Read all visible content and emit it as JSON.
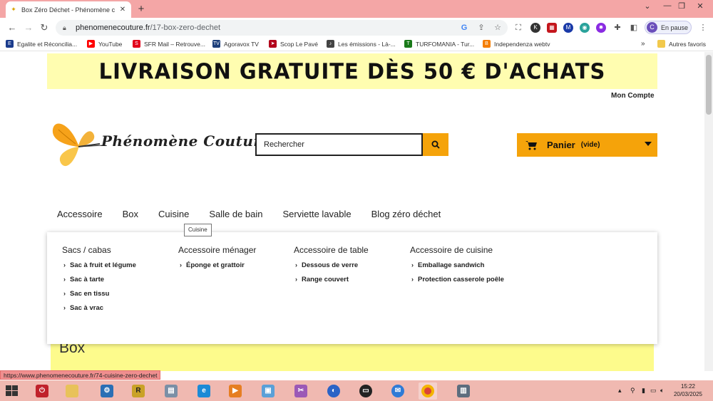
{
  "browser": {
    "tab_title": "Box Zéro Déchet - Phénomène c",
    "url_host": "phenomenecouture.fr",
    "url_path": "/17-box-zero-dechet",
    "profile_initial": "C",
    "profile_status": "En pause",
    "window_controls": [
      "⌄",
      "—",
      "❐",
      "✕"
    ]
  },
  "bookmarks": {
    "items": [
      {
        "label": "Egalite et Réconcilia...",
        "icon": "egalite-icon",
        "color": "#1a3b8c"
      },
      {
        "label": "YouTube",
        "icon": "youtube-icon",
        "color": "#ff0000"
      },
      {
        "label": "SFR Mail – Retrouve...",
        "icon": "sfr-icon",
        "color": "#e2001a"
      },
      {
        "label": "Agoravox TV",
        "icon": "agoravox-icon",
        "color": "#1d3f7a"
      },
      {
        "label": "Scop Le Pavé",
        "icon": "scop-icon",
        "color": "#b3001b"
      },
      {
        "label": "Les émissions - Là-...",
        "icon": "emissions-icon",
        "color": "#444444"
      },
      {
        "label": "TURFOMANIA - Tur...",
        "icon": "turfomania-icon",
        "color": "#1a7a1a"
      },
      {
        "label": "Independenza webtv",
        "icon": "blogger-icon",
        "color": "#f57d00"
      }
    ],
    "more": "»",
    "other_label": "Autres favoris"
  },
  "page": {
    "promo": "LIVRAISON GRATUITE  DÈS 50 € D'ACHATS",
    "account": "Mon Compte",
    "logo_text": "Phénomène Couture",
    "search_placeholder": "Rechercher",
    "cart_label": "Panier",
    "cart_state": "(vide)",
    "menu": [
      "Accessoire",
      "Box",
      "Cuisine",
      "Salle de bain",
      "Serviette lavable",
      "Blog zéro déchet"
    ],
    "tooltip": "Cuisine",
    "mega_menu": [
      {
        "heading": "Sacs / cabas",
        "items": [
          "Sac à fruit et légume",
          "Sac à tarte",
          "Sac en tissu",
          "Sac à vrac"
        ]
      },
      {
        "heading": "Accessoire ménager",
        "items": [
          "Éponge et grattoir"
        ]
      },
      {
        "heading": "Accessoire de table",
        "items": [
          "Dessous de verre",
          "Range couvert"
        ]
      },
      {
        "heading": "Accessoire de cuisine",
        "items": [
          "Emballage sandwich",
          "Protection casserole poêle"
        ]
      }
    ],
    "section_heading": "Box",
    "status_url": "https://www.phenomenecouture.fr/74-cuisine-zero-dechet"
  },
  "taskbar": {
    "time": "15:22",
    "date": "20/03/2025"
  },
  "colors": {
    "accent": "#f5a30a",
    "promo_bg": "#fffdb0",
    "tab_strip": "#f4a6a6",
    "taskbar": "#f0b9b1"
  }
}
